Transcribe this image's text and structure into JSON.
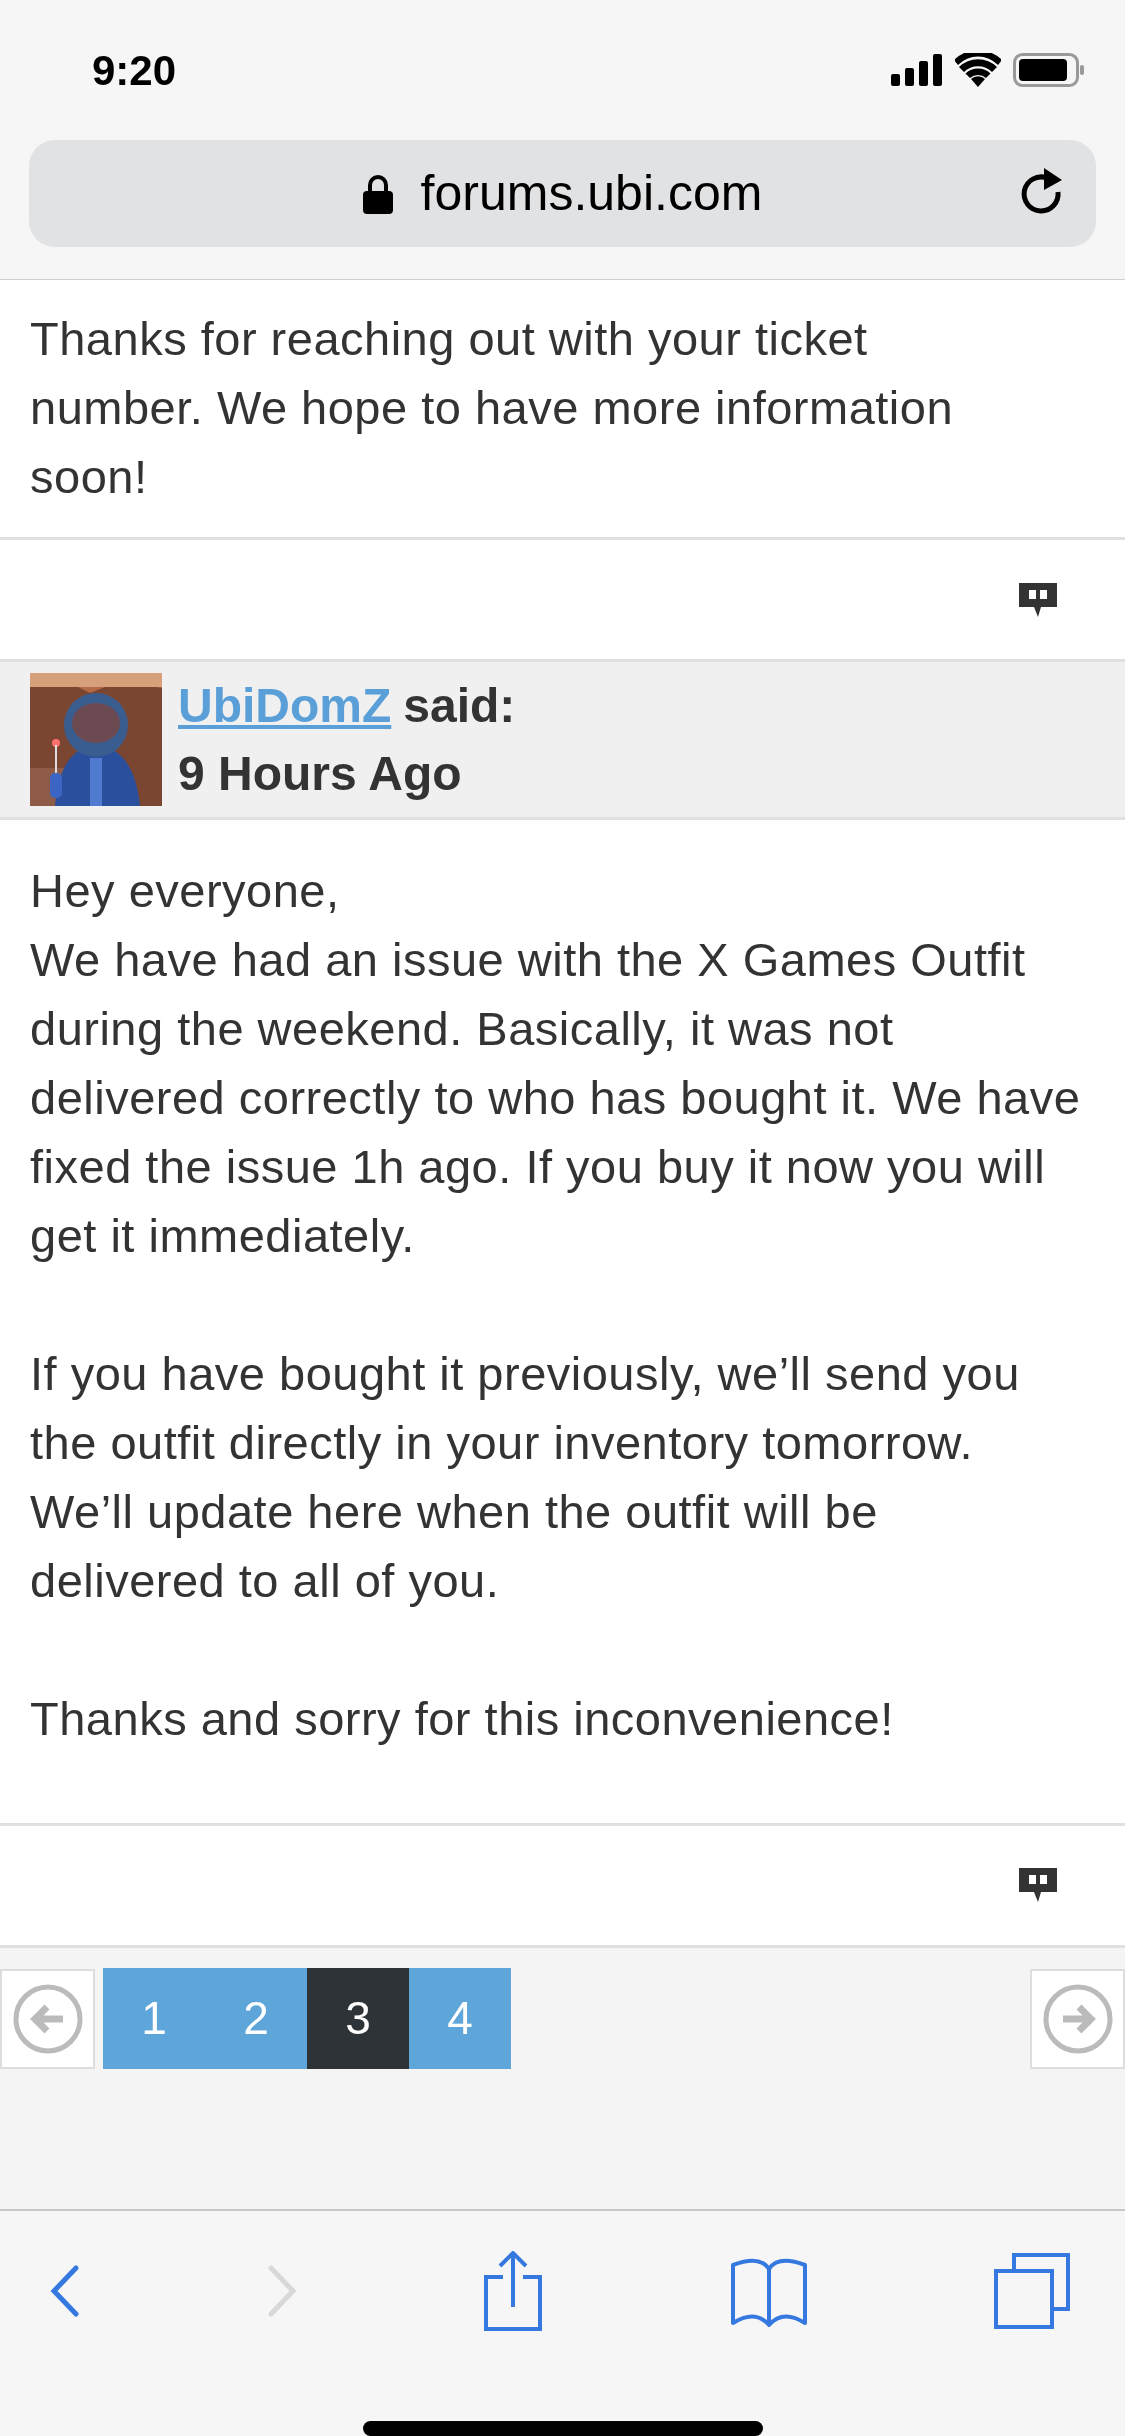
{
  "status_bar": {
    "time": "9:20"
  },
  "address_bar": {
    "url": "forums.ubi.com"
  },
  "posts": [
    {
      "paragraphs": [
        {
          "lines": [
            "Thanks for reaching out with your ticket number. We hope to have more information soon!"
          ]
        }
      ]
    },
    {
      "author": {
        "name": "UbiDomZ",
        "said": "said:",
        "time": "9 Hours Ago"
      },
      "paragraphs": [
        {
          "lines": [
            "Hey everyone,",
            "We have had an issue with the X Games Outfit during the weekend. Basically, it was not delivered correctly to who has bought it. We have fixed the issue 1h ago. If you buy it now you will get it immediately."
          ]
        },
        {
          "lines": [
            "If you have bought it previously, we’ll send you the outfit directly in your inventory tomorrow. We’ll update here when the outfit will be delivered to all of you."
          ]
        },
        {
          "lines": [
            "Thanks and sorry for this inconvenience!"
          ]
        }
      ]
    }
  ],
  "pagination": {
    "pages": [
      {
        "label": "1",
        "selected": false
      },
      {
        "label": "2",
        "selected": false
      },
      {
        "label": "3",
        "selected": true
      },
      {
        "label": "4",
        "selected": false
      }
    ]
  },
  "toolbar": {
    "back_enabled": true,
    "forward_enabled": false
  }
}
